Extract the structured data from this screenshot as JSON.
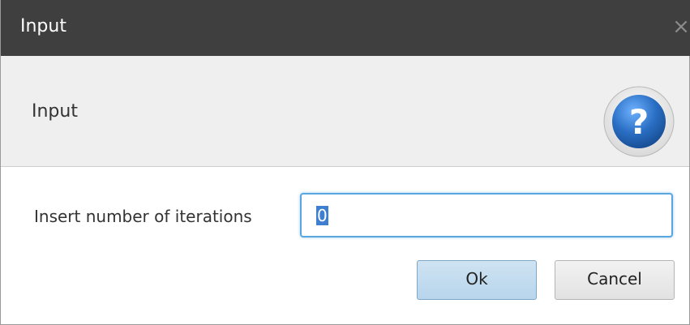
{
  "window": {
    "title": "Input",
    "close_glyph": "×"
  },
  "header": {
    "title": "Input",
    "icon": "help-icon",
    "icon_glyph": "?",
    "icon_color": "#2a6fc4"
  },
  "form": {
    "label": "Insert number of iterations",
    "iterations_value": "0"
  },
  "buttons": {
    "ok_label": "Ok",
    "cancel_label": "Cancel"
  },
  "colors": {
    "titlebar": "#3f3f3f",
    "header_background": "#efefef",
    "focus_border": "#5aa7e0",
    "ok_button": "#c3dcef"
  }
}
